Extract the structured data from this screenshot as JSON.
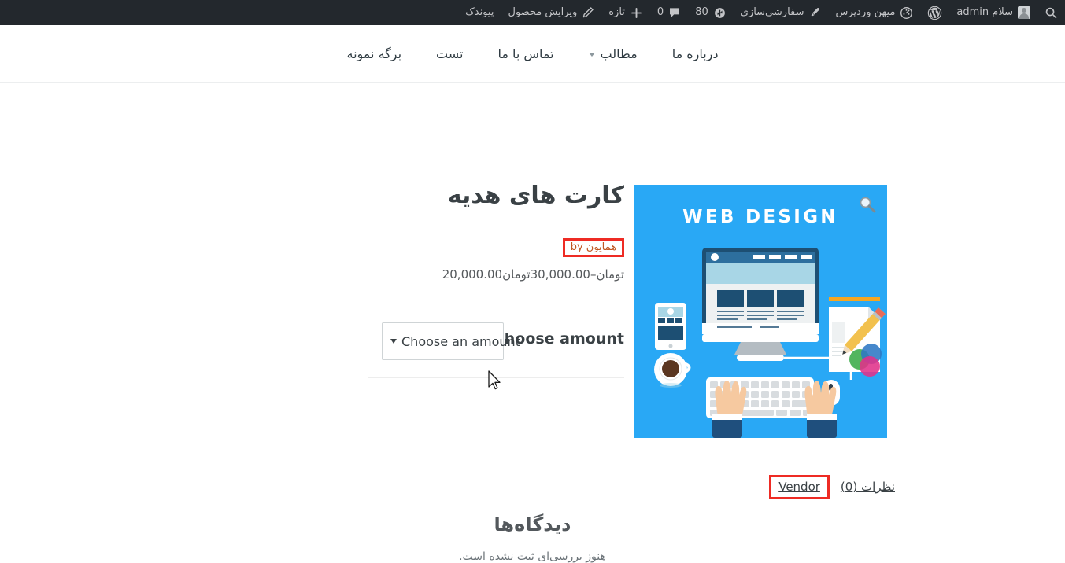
{
  "adminbar": {
    "search_icon": "search-icon",
    "greeting": "سلام admin",
    "wp_logo_icon": "wordpress-logo-icon",
    "site_name": "میهن وردپرس",
    "site_icon": "dashboard-home-icon",
    "customize": "سفارشی‌سازی",
    "customize_icon": "paintbrush-icon",
    "updates_count": "80",
    "updates_icon": "updates-refresh-icon",
    "comments_count": "0",
    "comments_icon": "comment-bubble-icon",
    "new": "تازه",
    "new_icon": "plus-icon",
    "edit_product": "ویرایش محصول",
    "edit_icon": "pencil-icon",
    "permalink": "پیوندک"
  },
  "nav": {
    "items": [
      {
        "label": "درباره ما",
        "has_dropdown": false
      },
      {
        "label": "مطالب",
        "has_dropdown": true
      },
      {
        "label": "تماس با ما",
        "has_dropdown": false
      },
      {
        "label": "تست",
        "has_dropdown": false
      },
      {
        "label": "برگه نمونه",
        "has_dropdown": false
      }
    ]
  },
  "product": {
    "title": "کارت های هدیه",
    "by_prefix": "by",
    "vendor_name": "همایون",
    "price_range": "20,000.00تومان–30,000.00تومان",
    "amount_label": "Choose amount",
    "amount_selected": "Choose an amount",
    "amount_options": [
      "Choose an amount"
    ],
    "gallery_zoom_icon": "magnifier-zoom-icon",
    "gallery_image_text": "WEB DESIGN"
  },
  "tabs": {
    "items": [
      {
        "label": "نظرات (0)",
        "highlighted": false,
        "name": "tab-reviews"
      },
      {
        "label": "Vendor",
        "highlighted": true,
        "name": "tab-vendor"
      }
    ]
  },
  "reviews": {
    "heading": "دیدگاه‌ها",
    "subtext": "هنوز بررسی‌ای ثبت نشده است."
  },
  "colors": {
    "adminbar_bg": "#23282d",
    "adminbar_text": "#c3c4c7",
    "accent_red_box": "#ee2b24",
    "vendor_link": "#c05621",
    "image_blue": "#29a8f5",
    "text_dark": "#3a4145"
  }
}
